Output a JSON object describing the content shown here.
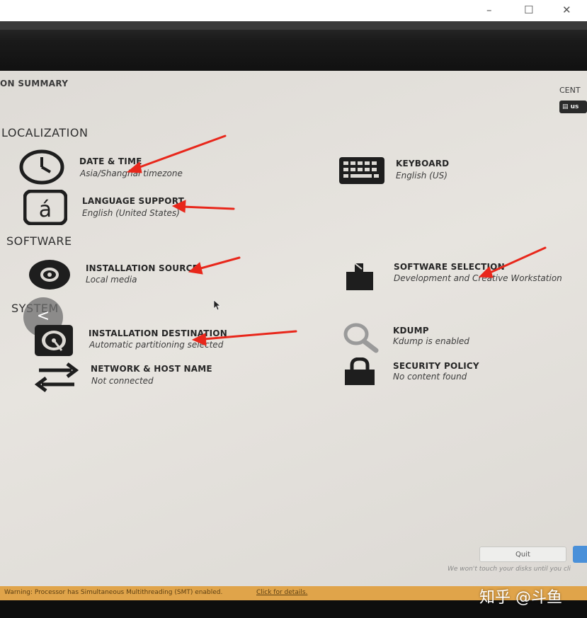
{
  "window_controls": {
    "minimize": "–",
    "maximize": "☐",
    "close": "✕"
  },
  "header": {
    "title": "ON SUMMARY",
    "right_label": "CENT",
    "keyboard_badge": "us"
  },
  "sections": {
    "localization": "LOCALIZATION",
    "software": "SOFTWARE",
    "system": "SYSTEM"
  },
  "spokes": {
    "date_time": {
      "title": "DATE & TIME",
      "status": "Asia/Shanghai timezone",
      "icon": "clock-icon"
    },
    "keyboard": {
      "title": "KEYBOARD",
      "status": "English (US)",
      "icon": "keyboard-icon"
    },
    "language_support": {
      "title": "LANGUAGE SUPPORT",
      "status": "English (United States)",
      "icon": "language-icon"
    },
    "installation_source": {
      "title": "INSTALLATION SOURCE",
      "status": "Local media",
      "icon": "disc-icon"
    },
    "software_selection": {
      "title": "SOFTWARE SELECTION",
      "status": "Development and Creative Workstation",
      "icon": "package-icon"
    },
    "installation_destination": {
      "title": "INSTALLATION DESTINATION",
      "status": "Automatic partitioning selected",
      "icon": "hard-disk-icon"
    },
    "kdump": {
      "title": "KDUMP",
      "status": "Kdump is enabled",
      "icon": "magnifier-icon"
    },
    "network": {
      "title": "NETWORK & HOST NAME",
      "status": "Not connected",
      "icon": "network-arrows-icon"
    },
    "security_policy": {
      "title": "SECURITY POLICY",
      "status": "No content found",
      "icon": "lock-icon"
    }
  },
  "overlay_back_button": "<",
  "footer": {
    "quit_label": "Quit",
    "note": "We won't touch your disks until you cli",
    "warning": "Warning: Processor has Simultaneous Multithreading (SMT) enabled.",
    "warning_link": "Click for details."
  },
  "watermark": "知乎 @斗鱼",
  "colors": {
    "annotation_arrow": "#e8271b",
    "warning_bar": "#e0a44a",
    "screen_bg": "#e3e0db"
  }
}
